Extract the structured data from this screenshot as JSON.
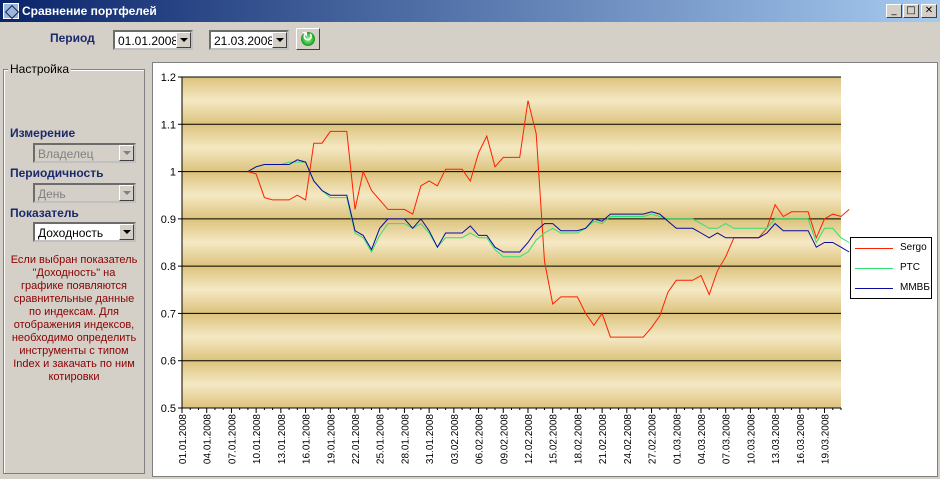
{
  "window": {
    "title": "Сравнение портфелей"
  },
  "toolbar": {
    "period_label": "Период",
    "date_from": "01.01.2008",
    "date_to": "21.03.2008"
  },
  "settings": {
    "title": "Настройка",
    "dimension": {
      "label": "Измерение",
      "value": "Владелец"
    },
    "periodicity": {
      "label": "Периодичность",
      "value": "День"
    },
    "indicator": {
      "label": "Показатель",
      "value": "Доходность"
    },
    "info_lines": [
      "Если выбран показатель",
      "\"Доходность\" на",
      "графике появляются",
      "сравнительные данные",
      "по индексам. Для",
      "отображения индексов,",
      "необходимо определить",
      "инструменты с типом",
      "Index и закачать по ним",
      "котировки"
    ]
  },
  "colors": {
    "sergo": "#ff2000",
    "rts": "#30e070",
    "micex": "#0a0aa0"
  },
  "chart_data": {
    "type": "line",
    "ylim": [
      0.5,
      1.2
    ],
    "yticks": [
      "0.5",
      "0.6",
      "0.7",
      "0.8",
      "0.9",
      "1",
      "1.1",
      "1.2"
    ],
    "x_tick_labels": [
      "01.01.2008",
      "04.01.2008",
      "07.01.2008",
      "10.01.2008",
      "13.01.2008",
      "16.01.2008",
      "19.01.2008",
      "22.01.2008",
      "25.01.2008",
      "28.01.2008",
      "31.01.2008",
      "03.02.2008",
      "06.02.2008",
      "09.02.2008",
      "12.02.2008",
      "15.02.2008",
      "18.02.2008",
      "21.02.2008",
      "24.02.2008",
      "27.02.2008",
      "01.03.2008",
      "04.03.2008",
      "07.03.2008",
      "10.03.2008",
      "13.03.2008",
      "16.03.2008",
      "19.03.2008"
    ],
    "x": [
      "09.01",
      "10.01",
      "11.01",
      "12.01",
      "13.01",
      "14.01",
      "15.01",
      "16.01",
      "17.01",
      "18.01",
      "19.01",
      "20.01",
      "21.01",
      "22.01",
      "23.01",
      "24.01",
      "25.01",
      "26.01",
      "27.01",
      "28.01",
      "29.01",
      "30.01",
      "31.01",
      "01.02",
      "02.02",
      "03.02",
      "04.02",
      "05.02",
      "06.02",
      "07.02",
      "08.02",
      "09.02",
      "10.02",
      "11.02",
      "12.02",
      "13.02",
      "14.02",
      "15.02",
      "16.02",
      "17.02",
      "18.02",
      "19.02",
      "20.02",
      "21.02",
      "22.02",
      "23.02",
      "24.02",
      "25.02",
      "26.02",
      "27.02",
      "28.02",
      "29.02",
      "01.03",
      "02.03",
      "03.03",
      "04.03",
      "05.03",
      "06.03",
      "07.03",
      "08.03",
      "09.03",
      "10.03",
      "11.03",
      "12.03",
      "13.03",
      "14.03",
      "15.03",
      "16.03",
      "17.03",
      "18.03",
      "19.03",
      "20.03",
      "21.03"
    ],
    "series": [
      {
        "name": "Sergo",
        "color_key": "sergo",
        "values": [
          1.0,
          0.995,
          0.945,
          0.94,
          0.94,
          0.94,
          0.95,
          0.94,
          1.06,
          1.06,
          1.085,
          1.085,
          1.085,
          0.92,
          1.0,
          0.96,
          0.94,
          0.92,
          0.92,
          0.92,
          0.91,
          0.97,
          0.98,
          0.97,
          1.005,
          1.005,
          1.005,
          0.98,
          1.04,
          1.075,
          1.01,
          1.03,
          1.03,
          1.03,
          1.15,
          1.08,
          0.81,
          0.72,
          0.735,
          0.735,
          0.735,
          0.7,
          0.675,
          0.7,
          0.65,
          0.65,
          0.65,
          0.65,
          0.65,
          0.67,
          0.695,
          0.745,
          0.77,
          0.77,
          0.77,
          0.78,
          0.74,
          0.79,
          0.82,
          0.86,
          0.86,
          0.86,
          0.86,
          0.88,
          0.93,
          0.905,
          0.915,
          0.915,
          0.915,
          0.86,
          0.9,
          0.91,
          0.905,
          0.92
        ]
      },
      {
        "name": "PTC",
        "color_key": "rts",
        "values": [
          1.0,
          1.01,
          1.015,
          1.015,
          1.015,
          1.02,
          1.02,
          1.02,
          0.98,
          0.96,
          0.945,
          0.945,
          0.945,
          0.87,
          0.86,
          0.83,
          0.865,
          0.89,
          0.89,
          0.89,
          0.88,
          0.89,
          0.87,
          0.84,
          0.86,
          0.86,
          0.86,
          0.87,
          0.86,
          0.86,
          0.835,
          0.82,
          0.82,
          0.82,
          0.83,
          0.855,
          0.87,
          0.88,
          0.87,
          0.87,
          0.87,
          0.88,
          0.895,
          0.89,
          0.905,
          0.905,
          0.905,
          0.905,
          0.905,
          0.91,
          0.905,
          0.9,
          0.9,
          0.9,
          0.9,
          0.89,
          0.88,
          0.88,
          0.89,
          0.88,
          0.88,
          0.88,
          0.88,
          0.88,
          0.9,
          0.9,
          0.9,
          0.9,
          0.9,
          0.85,
          0.88,
          0.88,
          0.86,
          0.85
        ]
      },
      {
        "name": "ММВБ",
        "color_key": "micex",
        "values": [
          1.0,
          1.01,
          1.015,
          1.015,
          1.015,
          1.015,
          1.025,
          1.02,
          0.98,
          0.96,
          0.95,
          0.95,
          0.95,
          0.875,
          0.865,
          0.835,
          0.88,
          0.9,
          0.9,
          0.9,
          0.88,
          0.9,
          0.875,
          0.84,
          0.87,
          0.87,
          0.87,
          0.885,
          0.865,
          0.865,
          0.84,
          0.83,
          0.83,
          0.83,
          0.85,
          0.875,
          0.89,
          0.89,
          0.875,
          0.875,
          0.875,
          0.88,
          0.9,
          0.895,
          0.91,
          0.91,
          0.91,
          0.91,
          0.91,
          0.915,
          0.91,
          0.895,
          0.88,
          0.88,
          0.88,
          0.87,
          0.86,
          0.87,
          0.86,
          0.86,
          0.86,
          0.86,
          0.86,
          0.87,
          0.89,
          0.875,
          0.875,
          0.875,
          0.875,
          0.84,
          0.85,
          0.85,
          0.84,
          0.83
        ]
      }
    ]
  }
}
